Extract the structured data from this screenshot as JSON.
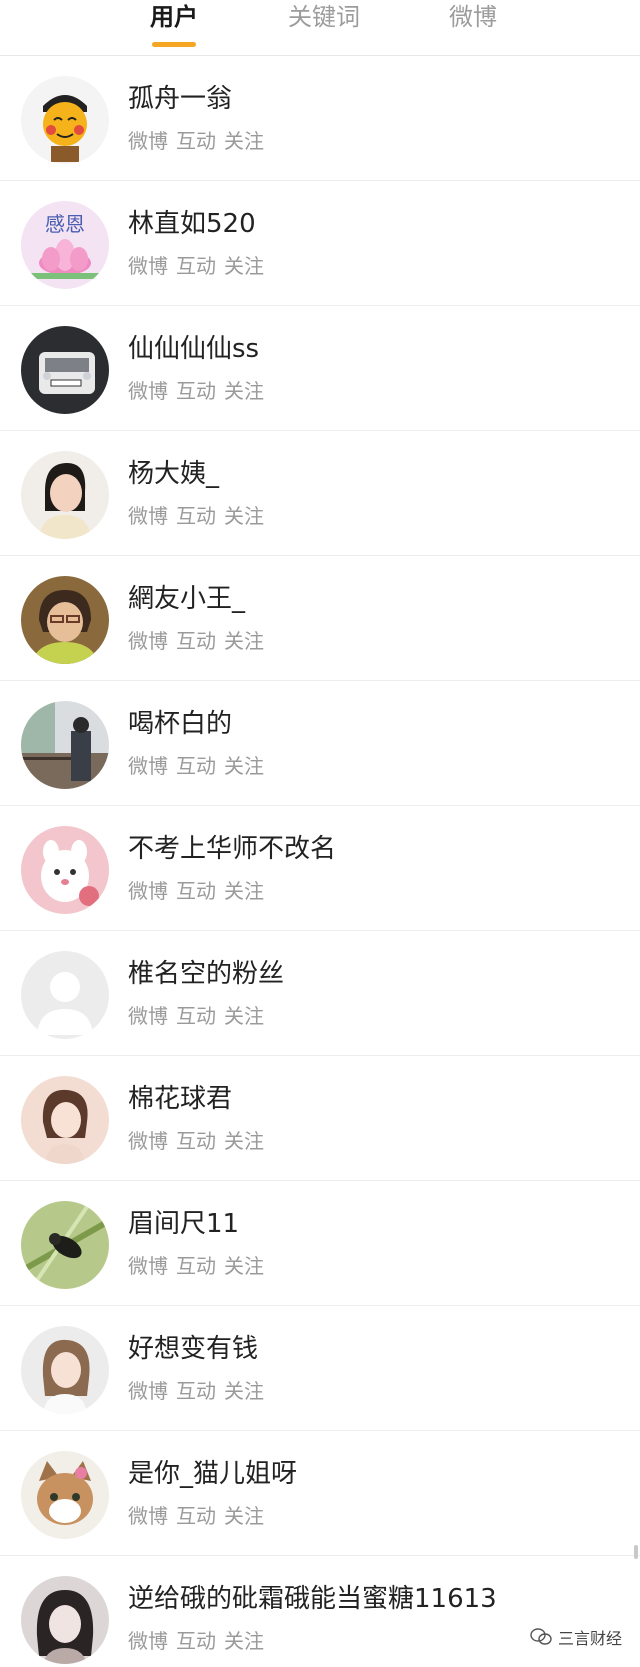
{
  "tabs": [
    {
      "label": "用户",
      "active": true
    },
    {
      "label": "关键词",
      "active": false
    },
    {
      "label": "微博",
      "active": false
    }
  ],
  "accent_color": "#f5a623",
  "action_labels": [
    "微博",
    "互动",
    "关注"
  ],
  "users": [
    {
      "name": "孤舟一翁",
      "avatar": "cartoon-face-avatar"
    },
    {
      "name": "林直如520",
      "avatar": "lotus-avatar",
      "avatar_text": "感恩"
    },
    {
      "name": "仙仙仙仙ss",
      "avatar": "car-avatar"
    },
    {
      "name": "杨大姨_",
      "avatar": "woman-portrait-avatar"
    },
    {
      "name": "網友小王_",
      "avatar": "older-woman-avatar"
    },
    {
      "name": "喝杯白的",
      "avatar": "balcony-photo-avatar"
    },
    {
      "name": "不考上华师不改名",
      "avatar": "plush-toy-avatar"
    },
    {
      "name": "椎名空的粉丝",
      "avatar": "default-avatar"
    },
    {
      "name": "棉花球君",
      "avatar": "illustrated-girl-avatar"
    },
    {
      "name": "眉间尺11",
      "avatar": "insect-avatar"
    },
    {
      "name": "好想变有钱",
      "avatar": "girl-selfie-avatar"
    },
    {
      "name": "是你_猫儿姐呀",
      "avatar": "cat-avatar"
    },
    {
      "name": "逆给硪的砒霜硪能当蜜糖11613",
      "avatar": "blurry-girl-avatar"
    }
  ],
  "watermark": {
    "text": "三言财经",
    "icon": "wechat-icon"
  }
}
